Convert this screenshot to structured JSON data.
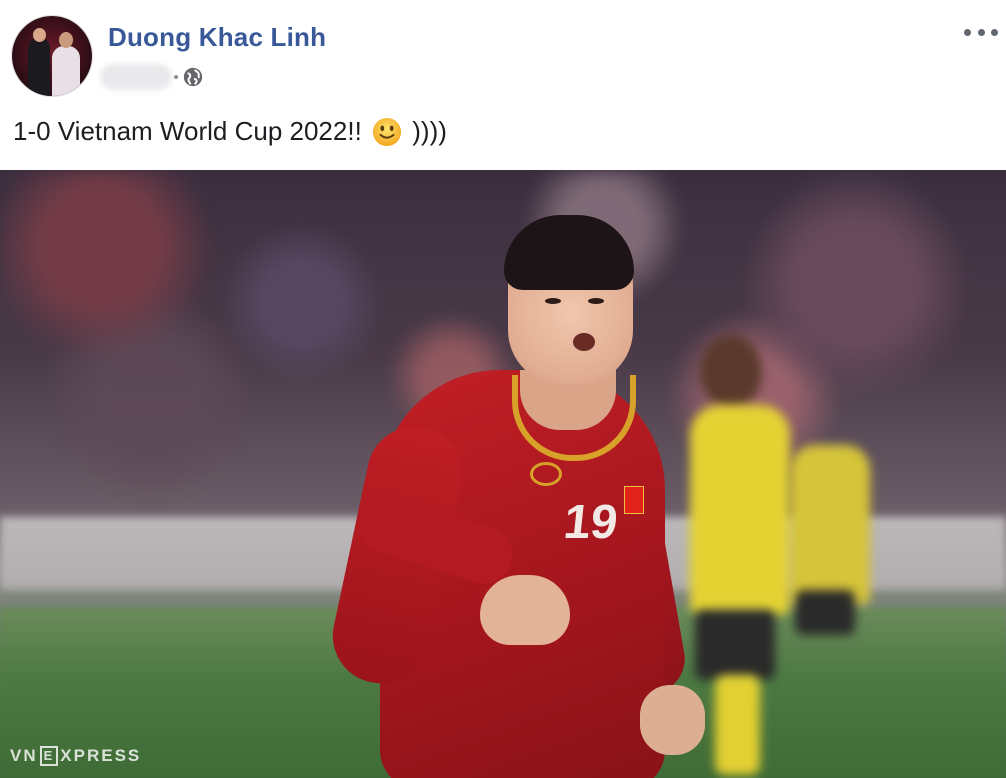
{
  "post": {
    "author": "Duong Khac Linh",
    "privacy_icon": "globe-icon",
    "more_icon": "more-horizontal-icon",
    "text_before_emoji": "1-0 Vietnam World Cup 2022!!",
    "text_after_emoji": "))))",
    "emoji_icon": "slightly-smiling-face-icon"
  },
  "photo": {
    "jersey_number": "19",
    "watermark_left": "VN",
    "watermark_box": "E",
    "watermark_right": "XPRESS"
  },
  "colors": {
    "author_link": "#385898",
    "text": "#1c1e21",
    "jersey_red": "#c21f26",
    "opponent_yellow": "#e4d233"
  }
}
